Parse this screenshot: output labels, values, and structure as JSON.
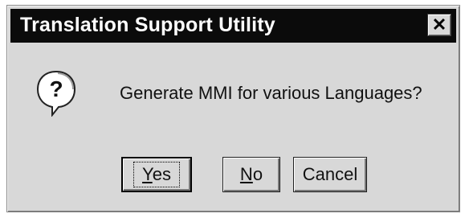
{
  "window": {
    "title": "Translation Support Utility",
    "close_glyph": "✕"
  },
  "dialog": {
    "icon": "question-icon",
    "message": "Generate MMI for various Languages?"
  },
  "buttons": {
    "yes": {
      "mnemonic": "Y",
      "rest": "es"
    },
    "no": {
      "mnemonic": "N",
      "rest": "o"
    },
    "cancel": {
      "label": "Cancel"
    }
  },
  "colors": {
    "titlebar_bg": "#0b0b0b",
    "dialog_bg": "#d8d8d8"
  }
}
